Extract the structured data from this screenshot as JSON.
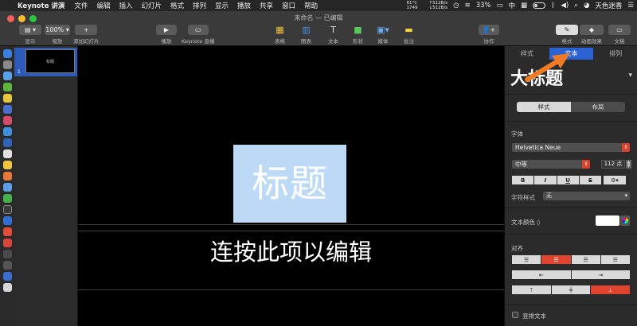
{
  "menubar": {
    "app_name": "Keynote 讲演",
    "items": [
      "文件",
      "编辑",
      "插入",
      "幻灯片",
      "格式",
      "排列",
      "显示",
      "播放",
      "共享",
      "窗口",
      "帮助"
    ],
    "cpu_temp": "61°C",
    "fan": "1749",
    "net_up": "↑512B/s",
    "net_down": "↓512B/s",
    "battery": "33%",
    "input_method": "中",
    "user": "天色迷香"
  },
  "window": {
    "title": "未命名 — 已编辑"
  },
  "toolbar": {
    "view_label": "显示",
    "zoom_value": "100%",
    "zoom_label": "缩放",
    "add_slide_label": "添加幻灯片",
    "play_label": "播放",
    "keynote_live_label": "Keynote 直播",
    "table_label": "表格",
    "chart_label": "图表",
    "text_label": "文本",
    "shape_label": "形状",
    "media_label": "媒体",
    "comment_label": "批注",
    "collaborate_label": "协作",
    "format_label": "格式",
    "animate_label": "动画效果",
    "document_label": "文稿"
  },
  "navigator": {
    "slide_number": "1",
    "thumb_title": "标题"
  },
  "slide": {
    "title": "标题",
    "subtitle": "连按此项以编辑"
  },
  "inspector": {
    "tabs": [
      "样式",
      "文本",
      "排列"
    ],
    "active_tab": "文本",
    "paragraph_style": "大标题",
    "subtabs": [
      "样式",
      "布局"
    ],
    "font_section": "字体",
    "font_family": "Helvetica Neue",
    "font_weight": "中等",
    "font_size": "112 点",
    "bold": "B",
    "italic": "I",
    "underline": "U",
    "strike": "S",
    "char_style_label": "字符样式",
    "char_style_value": "无",
    "text_color_label": "文本颜色",
    "alignment_label": "对齐",
    "vertical_text_label": "竖排文本"
  },
  "colors": {
    "accent": "#2a62d4",
    "selection": "#bcd9f6",
    "active_red": "#e0442f",
    "arrow": "#f07a25"
  }
}
